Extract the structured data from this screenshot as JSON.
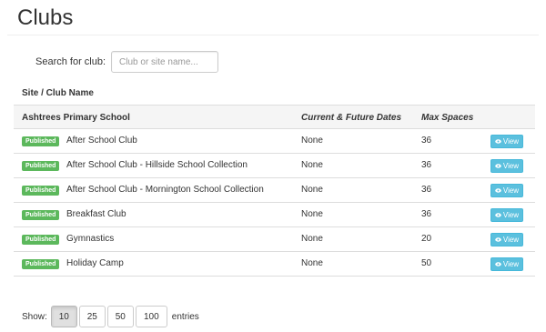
{
  "page": {
    "title": "Clubs"
  },
  "search": {
    "label": "Search for club:",
    "placeholder": "Club or site name...",
    "value": ""
  },
  "site_heading": "Site / Club Name",
  "table": {
    "columns": {
      "site": "Ashtrees Primary School",
      "dates": "Current & Future Dates",
      "max": "Max Spaces"
    },
    "rows": [
      {
        "status": "Published",
        "name": "After School Club",
        "dates": "None",
        "max": "36",
        "action": "View"
      },
      {
        "status": "Published",
        "name": "After School Club - Hillside School Collection",
        "dates": "None",
        "max": "36",
        "action": "View"
      },
      {
        "status": "Published",
        "name": "After School Club - Mornington School Collection",
        "dates": "None",
        "max": "36",
        "action": "View"
      },
      {
        "status": "Published",
        "name": "Breakfast Club",
        "dates": "None",
        "max": "36",
        "action": "View"
      },
      {
        "status": "Published",
        "name": "Gymnastics",
        "dates": "None",
        "max": "20",
        "action": "View"
      },
      {
        "status": "Published",
        "name": "Holiday Camp",
        "dates": "None",
        "max": "50",
        "action": "View"
      }
    ]
  },
  "pager": {
    "show_label": "Show:",
    "options": [
      "10",
      "25",
      "50",
      "100"
    ],
    "selected": "10",
    "entries_label": "entries"
  },
  "colors": {
    "published_badge": "#5cb85c",
    "view_button": "#5bc0de",
    "header_bg": "#f5f5f5"
  },
  "icons": {
    "view": "eye-icon"
  }
}
